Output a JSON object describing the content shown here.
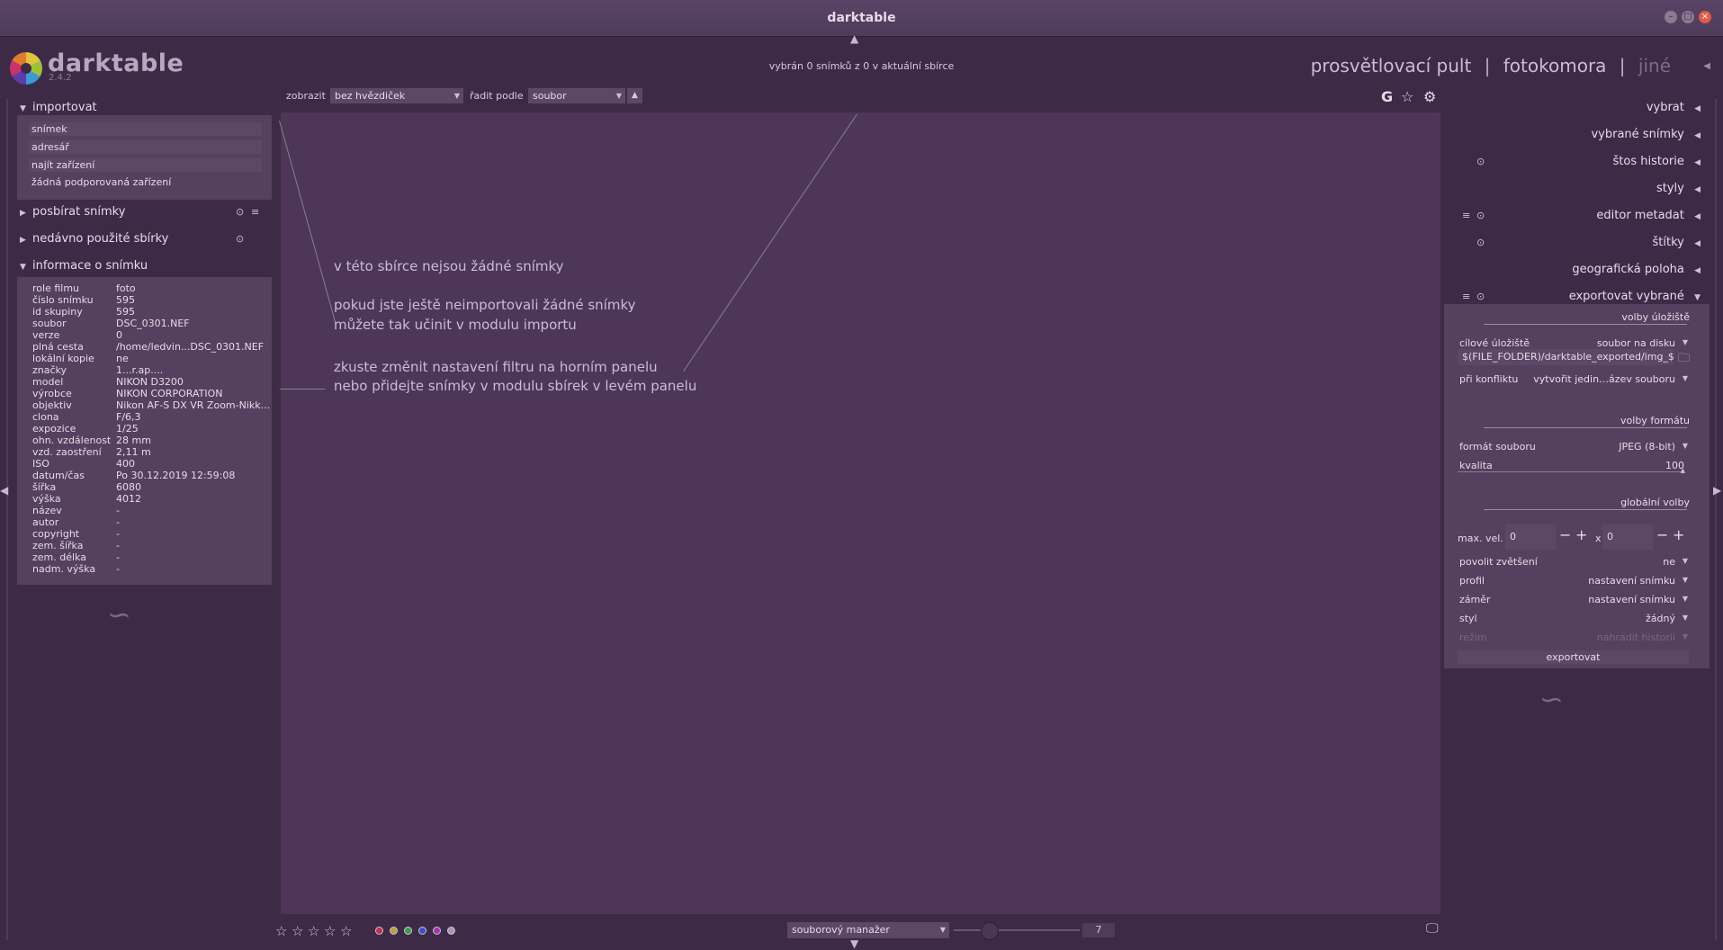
{
  "window": {
    "title": "darktable",
    "controls": [
      "–",
      "□",
      "×"
    ]
  },
  "logo": {
    "name": "darktable",
    "version": "2.4.2"
  },
  "selection_info": "vybrán 0 snímků z 0 v aktuální sbírce",
  "views": {
    "lighttable": "prosvětlovací pult",
    "darkroom": "fotokomora",
    "other": "jiné",
    "separator": "|"
  },
  "filter_bar": {
    "show_label": "zobrazit",
    "show_value": "bez hvězdiček",
    "sort_label": "řadit podle",
    "sort_value": "soubor",
    "sort_dir": "▲",
    "icons": {
      "grouping": "G",
      "star": "☆",
      "settings": "⚙"
    }
  },
  "left_panel": {
    "import": {
      "title": "importovat",
      "buttons": [
        "snímek",
        "adresář",
        "najít zařízení"
      ],
      "no_devices": "žádná podporovaná zařízení"
    },
    "collect": {
      "title": "posbírat snímky"
    },
    "recent": {
      "title": "nedávno použité sbírky"
    },
    "image_info": {
      "title": "informace o snímku",
      "rows": [
        {
          "key": "role filmu",
          "value": "foto"
        },
        {
          "key": "číslo snímku",
          "value": "595"
        },
        {
          "key": "id skupiny",
          "value": "595"
        },
        {
          "key": "soubor",
          "value": "DSC_0301.NEF"
        },
        {
          "key": "verze",
          "value": "0"
        },
        {
          "key": "plná cesta",
          "value": "/home/ledvin...DSC_0301.NEF"
        },
        {
          "key": "lokální kopie",
          "value": "ne"
        },
        {
          "key": "značky",
          "value": "1...r.ap...."
        },
        {
          "key": "model",
          "value": "NIKON D3200"
        },
        {
          "key": "výrobce",
          "value": "NIKON CORPORATION"
        },
        {
          "key": "objektiv",
          "value": "Nikon AF-S DX VR Zoom-Nikk..."
        },
        {
          "key": "clona",
          "value": "F/6,3"
        },
        {
          "key": "expozice",
          "value": "1/25"
        },
        {
          "key": "ohn. vzdálenost",
          "value": "28 mm"
        },
        {
          "key": "vzd. zaostření",
          "value": "2,11 m"
        },
        {
          "key": "ISO",
          "value": "400"
        },
        {
          "key": "datum/čas",
          "value": "Po 30.12.2019 12:59:08"
        },
        {
          "key": "šířka",
          "value": "6080"
        },
        {
          "key": "výška",
          "value": "4012"
        },
        {
          "key": "název",
          "value": "-"
        },
        {
          "key": "autor",
          "value": "-"
        },
        {
          "key": "copyright",
          "value": "-"
        },
        {
          "key": "zem. šířka",
          "value": "-"
        },
        {
          "key": "zem. délka",
          "value": "-"
        },
        {
          "key": "nadm. výška",
          "value": "-"
        }
      ]
    }
  },
  "center": {
    "msg1": "v této sbírce nejsou žádné snímky",
    "msg2": "pokud jste ještě neimportovali žádné snímky",
    "msg3": "můžete tak učinit v modulu importu",
    "msg4": "zkuste změnit nastavení filtru na horním panelu",
    "msg5": "nebo přidejte snímky v modulu sbírek v levém panelu"
  },
  "right_panel": {
    "modules": [
      "vybrat",
      "vybrané snímky",
      "štos historie",
      "styly",
      "editor metadat",
      "štítky",
      "geografická poloha",
      "exportovat vybrané"
    ],
    "export": {
      "storage_title": "volby úložiště",
      "target_label": "cílové úložiště",
      "target_value": "soubor na disku",
      "path": "$(FILE_FOLDER)/darktable_exported/img_$",
      "conflict_label": "při konfliktu",
      "conflict_value": "vytvořit jedin…ázev souboru",
      "format_title": "volby formátu",
      "format_label": "formát souboru",
      "format_value": "JPEG (8-bit)",
      "quality_label": "kvalita",
      "quality_value": "100",
      "global_title": "globální volby",
      "maxsize_label": "max. vel.",
      "max_w": "0",
      "x": "x",
      "max_h": "0",
      "upscale_label": "povolit zvětšení",
      "upscale_value": "ne",
      "profile_label": "profil",
      "profile_value": "nastavení snímku",
      "intent_label": "záměr",
      "intent_value": "nastavení snímku",
      "style_label": "styl",
      "style_value": "žádný",
      "mode_label": "režim",
      "mode_value": "nahradit historii",
      "export_button": "exportovat"
    }
  },
  "bottom_bar": {
    "stars": [
      "☆",
      "☆",
      "☆",
      "☆",
      "☆"
    ],
    "color_labels": [
      {
        "name": "red",
        "color": "#c0304a"
      },
      {
        "name": "yellow",
        "color": "#b8a23a"
      },
      {
        "name": "green",
        "color": "#3e9a4a"
      },
      {
        "name": "blue",
        "color": "#3a4ec8"
      },
      {
        "name": "purple",
        "color": "#9a3aa8"
      },
      {
        "name": "gray",
        "color": "#a89aae"
      }
    ],
    "layout_value": "souborový manažer",
    "zoom_value": "7"
  }
}
